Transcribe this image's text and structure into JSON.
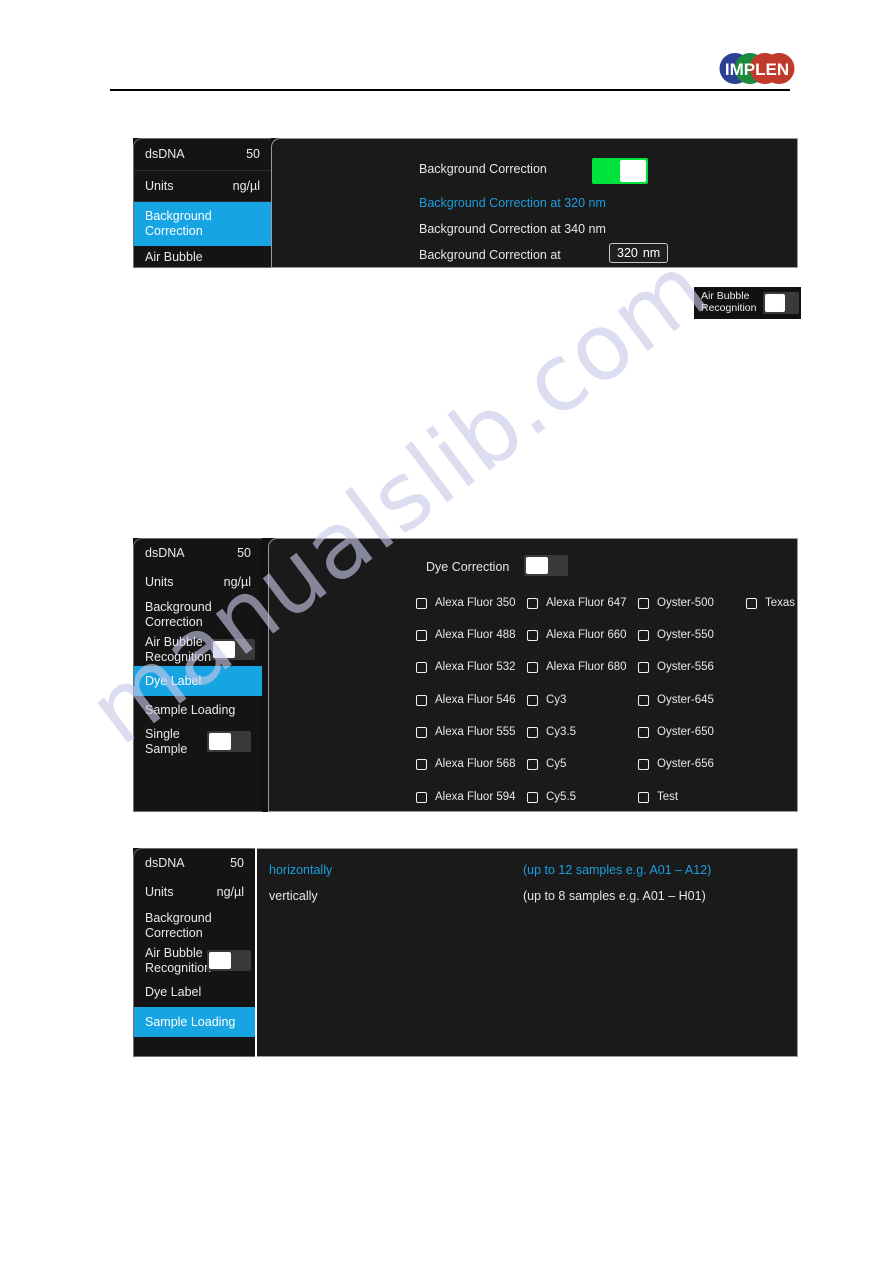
{
  "header": {
    "logo_text": "IMPLEN",
    "logo_name": "implen-logo"
  },
  "watermark": {
    "text": "manualslib.com"
  },
  "colors": {
    "accent_blue": "#16a5e2",
    "link_blue": "#1b9ede",
    "toggle_on_green": "#00e33c",
    "panel_bg": "#1a1a1a",
    "sidebar_bg": "#141414"
  },
  "panel_background_correction": {
    "sidebar": {
      "rows": [
        {
          "label": "dsDNA",
          "value": "50",
          "active": false,
          "type": "value"
        },
        {
          "label": "Units",
          "value": "ng/µl",
          "active": false,
          "type": "value"
        },
        {
          "label": "Background\nCorrection",
          "value": "",
          "active": true,
          "type": "nav"
        },
        {
          "label": "Air Bubble",
          "value": "",
          "active": false,
          "type": "clipped"
        }
      ]
    },
    "content": {
      "toggle_label": "Background Correction",
      "toggle_state": "on",
      "options": [
        {
          "label": "Background Correction at 320 nm",
          "selected": true
        },
        {
          "label": "Background Correction at 340 nm",
          "selected": false
        },
        {
          "label": "Background Correction at",
          "selected": false
        }
      ],
      "custom_value": "320",
      "custom_unit": "nm"
    }
  },
  "airbubble_chip": {
    "label": "Air Bubble\nRecognition",
    "toggle_state": "off"
  },
  "panel_dye_label": {
    "sidebar": {
      "rows": [
        {
          "label": "dsDNA",
          "value": "50",
          "kind": "value",
          "active": false
        },
        {
          "label": "Units",
          "value": "ng/µl",
          "kind": "value",
          "active": false
        },
        {
          "label": "Background\nCorrection",
          "value": "",
          "kind": "nav",
          "active": false
        },
        {
          "label": "Air Bubble\nRecognition",
          "value": "",
          "kind": "toggle",
          "active": false,
          "toggle_state": "off"
        },
        {
          "label": "Dye Label",
          "value": "",
          "kind": "nav",
          "active": true
        },
        {
          "label": "Sample Loading",
          "value": "",
          "kind": "nav",
          "active": false
        },
        {
          "label": "Single\nSample",
          "value": "",
          "kind": "toggle",
          "active": false,
          "toggle_state": "off"
        }
      ]
    },
    "content": {
      "toggle_label": "Dye Correction",
      "toggle_state": "off",
      "columns": [
        {
          "name": "alexa-fluor-column-1",
          "items": [
            "Alexa Fluor 350",
            "Alexa Fluor 488",
            "Alexa Fluor 532",
            "Alexa Fluor 546",
            "Alexa Fluor 555",
            "Alexa Fluor 568",
            "Alexa Fluor 594"
          ]
        },
        {
          "name": "alexa-cy-column-2",
          "items": [
            "Alexa Fluor 647",
            "Alexa Fluor 660",
            "Alexa Fluor 680",
            "Cy3",
            "Cy3.5",
            "Cy5",
            "Cy5.5"
          ]
        },
        {
          "name": "oyster-column-3",
          "items": [
            "Oyster-500",
            "Oyster-550",
            "Oyster-556",
            "Oyster-645",
            "Oyster-650",
            "Oyster-656",
            "Test"
          ]
        },
        {
          "name": "misc-column-4",
          "items": [
            "Texas Red"
          ]
        }
      ]
    }
  },
  "panel_sample_loading": {
    "sidebar": {
      "rows": [
        {
          "label": "dsDNA",
          "value": "50",
          "kind": "value",
          "active": false
        },
        {
          "label": "Units",
          "value": "ng/µl",
          "kind": "value",
          "active": false
        },
        {
          "label": "Background\nCorrection",
          "value": "",
          "kind": "nav",
          "active": false
        },
        {
          "label": "Air Bubble\nRecognition",
          "value": "",
          "kind": "toggle",
          "active": false,
          "toggle_state": "off"
        },
        {
          "label": "Dye Label",
          "value": "",
          "kind": "nav",
          "active": false
        },
        {
          "label": "Sample Loading",
          "value": "",
          "kind": "nav",
          "active": true
        }
      ]
    },
    "content": {
      "options": [
        {
          "label": "horizontally",
          "hint": "(up to 12 samples e.g. A01 – A12)",
          "selected": true
        },
        {
          "label": "vertically",
          "hint": "(up to 8 samples e.g. A01 – H01)",
          "selected": false
        }
      ]
    }
  }
}
